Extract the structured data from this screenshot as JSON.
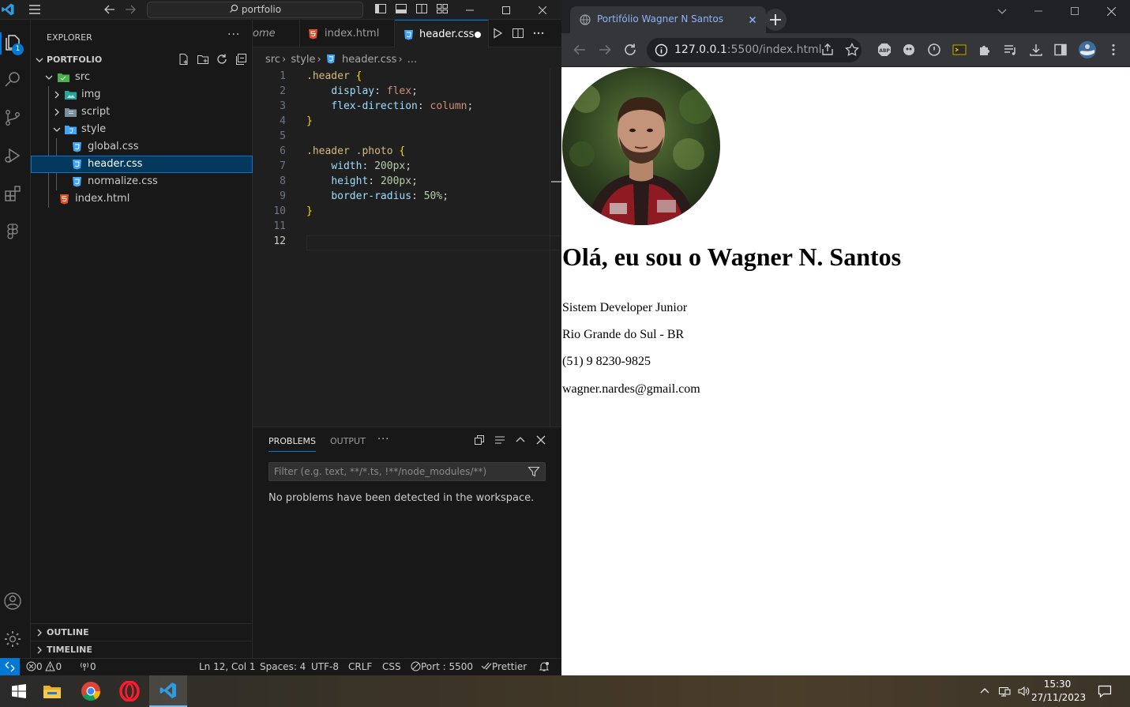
{
  "vscode": {
    "search_text": "portfolio",
    "explorer_title": "EXPLORER",
    "explorer_more": "···",
    "badge": "1",
    "tree": {
      "root": "PORTFOLIO",
      "src": "src",
      "img": "img",
      "script": "script",
      "style": "style",
      "global": "global.css",
      "header": "header.css",
      "normalize": "normalize.css",
      "index": "index.html"
    },
    "outline": "OUTLINE",
    "timeline": "TIMELINE",
    "tabs": {
      "welcome": "ome",
      "index": "index.html",
      "header": "header.css"
    },
    "breadcrumb": {
      "p1": "src",
      "p2": "style",
      "p3": "header.css",
      "p4": "..."
    },
    "code": {
      "l1": ".header",
      "l1b": " {",
      "l2p": "display",
      "l2v": "flex",
      "l3p": "flex-direction",
      "l3v": "column",
      "l4": "}",
      "l6": ".header .photo",
      "l6b": " {",
      "l7p": "width",
      "l7v": "200px",
      "l8p": "height",
      "l8v": "200px",
      "l9p": "border-radius",
      "l9v": "50%",
      "l10": "}"
    },
    "line_numbers": [
      "1",
      "2",
      "3",
      "4",
      "5",
      "6",
      "7",
      "8",
      "9",
      "10",
      "11",
      "12"
    ],
    "panel": {
      "problems": "PROBLEMS",
      "output": "OUTPUT",
      "more": "···",
      "filter_placeholder": "Filter (e.g. text, **/*.ts, !**/node_modules/**)",
      "message": "No problems have been detected in the workspace."
    },
    "status": {
      "errors": "0",
      "warnings": "0",
      "ports": "0",
      "position": "Ln 12, Col 1",
      "spaces": "Spaces: 4",
      "encoding": "UTF-8",
      "eol": "CRLF",
      "language": "CSS",
      "port": "Port : 5500",
      "prettier": "Prettier"
    }
  },
  "chrome": {
    "tab_title": "Portifólio Wagner N Santos",
    "url_host": "127.0.0.1",
    "url_path": ":5500/index.html"
  },
  "page": {
    "name": "Olá, eu sou o Wagner N. Santos",
    "role": "Sistem Developer Junior",
    "location": "Rio Grande do Sul - BR",
    "phone": "(51) 9 8230-9825",
    "email": "wagner.nardes@gmail.com"
  },
  "taskbar": {
    "time": "15:30",
    "date": "27/11/2023"
  },
  "colors": {
    "vscode_bg": "#1f1f1f",
    "vscode_accent": "#0078d4",
    "chrome_bg": "#202124",
    "chrome_toolbar": "#35363a",
    "link_blue": "#8ab4f8"
  }
}
